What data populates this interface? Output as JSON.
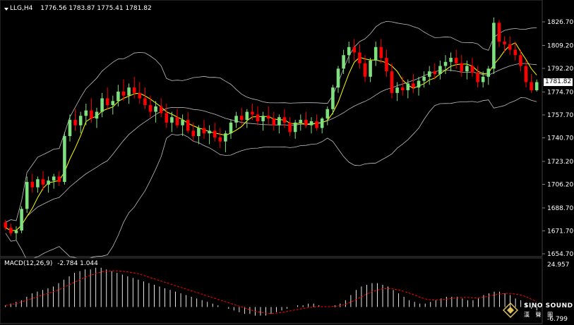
{
  "header": {
    "symbol_tf": "LLG,H4",
    "ohlc": "1776.56 1783.87 1775.41 1781.82"
  },
  "macd_header": {
    "label": "MACD(12,26,9)",
    "values": "-2.784 1.044"
  },
  "current_price_label": "1781.82",
  "logo": {
    "name": "SINO SOUND",
    "sub": "漢 聲 圖"
  },
  "colors": {
    "bull": "#7fe07f",
    "bear": "#ff0000",
    "ma": "#ffff00",
    "bands": "#bfbfbf",
    "macd_signal": "#ff0000",
    "macd_hist": "#ffffff"
  },
  "chart_data": [
    {
      "type": "candlestick",
      "yaxis_ticks": [
        1826.7,
        1809.2,
        1792.2,
        1774.7,
        1757.7,
        1740.7,
        1723.2,
        1706.2,
        1688.7,
        1671.7,
        1654.7
      ],
      "ylim": [
        1654.7,
        1834
      ],
      "ohlc": [
        [
          1678,
          1680,
          1672,
          1674
        ],
        [
          1674,
          1677,
          1668,
          1670
        ],
        [
          1670,
          1675,
          1665,
          1672
        ],
        [
          1672,
          1690,
          1670,
          1688
        ],
        [
          1688,
          1712,
          1685,
          1708
        ],
        [
          1708,
          1714,
          1700,
          1704
        ],
        [
          1704,
          1712,
          1700,
          1710
        ],
        [
          1710,
          1716,
          1702,
          1706
        ],
        [
          1706,
          1712,
          1700,
          1709
        ],
        [
          1709,
          1714,
          1703,
          1712
        ],
        [
          1712,
          1716,
          1705,
          1708
        ],
        [
          1708,
          1745,
          1706,
          1742
        ],
        [
          1742,
          1758,
          1738,
          1754
        ],
        [
          1754,
          1762,
          1746,
          1750
        ],
        [
          1750,
          1760,
          1744,
          1757
        ],
        [
          1757,
          1766,
          1750,
          1761
        ],
        [
          1761,
          1770,
          1752,
          1755
        ],
        [
          1755,
          1763,
          1748,
          1760
        ],
        [
          1760,
          1774,
          1756,
          1770
        ],
        [
          1770,
          1778,
          1762,
          1765
        ],
        [
          1765,
          1772,
          1758,
          1768
        ],
        [
          1768,
          1780,
          1764,
          1775
        ],
        [
          1775,
          1784,
          1768,
          1772
        ],
        [
          1772,
          1781,
          1766,
          1778
        ],
        [
          1778,
          1786,
          1770,
          1774
        ],
        [
          1774,
          1782,
          1766,
          1770
        ],
        [
          1770,
          1778,
          1762,
          1765
        ],
        [
          1765,
          1772,
          1756,
          1760
        ],
        [
          1760,
          1768,
          1752,
          1764
        ],
        [
          1764,
          1770,
          1756,
          1759
        ],
        [
          1759,
          1766,
          1748,
          1752
        ],
        [
          1752,
          1760,
          1745,
          1756
        ],
        [
          1756,
          1762,
          1748,
          1750
        ],
        [
          1750,
          1758,
          1742,
          1754
        ],
        [
          1754,
          1760,
          1744,
          1746
        ],
        [
          1746,
          1752,
          1738,
          1742
        ],
        [
          1742,
          1750,
          1736,
          1748
        ],
        [
          1748,
          1754,
          1740,
          1744
        ],
        [
          1744,
          1750,
          1736,
          1746
        ],
        [
          1746,
          1752,
          1738,
          1741
        ],
        [
          1741,
          1748,
          1733,
          1738
        ],
        [
          1738,
          1746,
          1730,
          1744
        ],
        [
          1744,
          1754,
          1740,
          1752
        ],
        [
          1752,
          1760,
          1748,
          1757
        ],
        [
          1757,
          1763,
          1750,
          1754
        ],
        [
          1754,
          1762,
          1748,
          1760
        ],
        [
          1760,
          1766,
          1754,
          1758
        ],
        [
          1758,
          1764,
          1750,
          1753
        ],
        [
          1753,
          1760,
          1746,
          1757
        ],
        [
          1757,
          1764,
          1750,
          1755
        ],
        [
          1755,
          1760,
          1746,
          1750
        ],
        [
          1750,
          1758,
          1744,
          1756
        ],
        [
          1756,
          1762,
          1748,
          1752
        ],
        [
          1752,
          1756,
          1742,
          1745
        ],
        [
          1745,
          1754,
          1740,
          1752
        ],
        [
          1752,
          1758,
          1746,
          1754
        ],
        [
          1754,
          1760,
          1748,
          1750
        ],
        [
          1750,
          1756,
          1744,
          1753
        ],
        [
          1753,
          1758,
          1746,
          1748
        ],
        [
          1748,
          1756,
          1744,
          1755
        ],
        [
          1755,
          1764,
          1750,
          1762
        ],
        [
          1762,
          1780,
          1758,
          1778
        ],
        [
          1778,
          1794,
          1774,
          1792
        ],
        [
          1792,
          1806,
          1788,
          1802
        ],
        [
          1802,
          1812,
          1796,
          1808
        ],
        [
          1808,
          1814,
          1798,
          1804
        ],
        [
          1804,
          1810,
          1792,
          1796
        ],
        [
          1796,
          1802,
          1782,
          1786
        ],
        [
          1786,
          1800,
          1782,
          1798
        ],
        [
          1798,
          1812,
          1794,
          1808
        ],
        [
          1808,
          1814,
          1796,
          1800
        ],
        [
          1800,
          1806,
          1786,
          1790
        ],
        [
          1790,
          1796,
          1770,
          1774
        ],
        [
          1774,
          1782,
          1768,
          1778
        ],
        [
          1778,
          1786,
          1772,
          1776
        ],
        [
          1776,
          1784,
          1770,
          1781
        ],
        [
          1781,
          1788,
          1774,
          1778
        ],
        [
          1778,
          1786,
          1772,
          1783
        ],
        [
          1783,
          1790,
          1778,
          1786
        ],
        [
          1786,
          1794,
          1780,
          1790
        ],
        [
          1790,
          1796,
          1784,
          1788
        ],
        [
          1788,
          1798,
          1784,
          1794
        ],
        [
          1794,
          1802,
          1788,
          1797
        ],
        [
          1797,
          1804,
          1790,
          1800
        ],
        [
          1800,
          1806,
          1792,
          1796
        ],
        [
          1796,
          1802,
          1786,
          1790
        ],
        [
          1790,
          1798,
          1784,
          1794
        ],
        [
          1794,
          1800,
          1786,
          1789
        ],
        [
          1789,
          1794,
          1778,
          1782
        ],
        [
          1782,
          1790,
          1778,
          1786
        ],
        [
          1786,
          1794,
          1780,
          1792
        ],
        [
          1792,
          1830,
          1788,
          1826
        ],
        [
          1826,
          1828,
          1808,
          1812
        ],
        [
          1812,
          1816,
          1804,
          1810
        ],
        [
          1810,
          1816,
          1802,
          1806
        ],
        [
          1806,
          1812,
          1798,
          1802
        ],
        [
          1802,
          1806,
          1790,
          1794
        ],
        [
          1794,
          1798,
          1778,
          1782
        ],
        [
          1782,
          1788,
          1774,
          1776
        ],
        [
          1776,
          1784,
          1775,
          1782
        ]
      ]
    },
    {
      "type": "macd",
      "yaxis_ticks": [
        24.957,
        -6.799
      ],
      "ylim": [
        -6.799,
        24.957
      ],
      "histogram": [
        1,
        2,
        3,
        4,
        6,
        8,
        9,
        10,
        11,
        12,
        14,
        16,
        18,
        20,
        21,
        22,
        22,
        23,
        23,
        22,
        21,
        20,
        19,
        18,
        17,
        16,
        15,
        14,
        13,
        12,
        11,
        10,
        9,
        8,
        7,
        6,
        5,
        4,
        3,
        2,
        1,
        0,
        -1,
        -2,
        -3,
        -4,
        -4,
        -5,
        -5,
        -5,
        -4,
        -3,
        -2,
        -1,
        0,
        1,
        1,
        2,
        2,
        1,
        0,
        0,
        1,
        2,
        4,
        7,
        10,
        12,
        13,
        14,
        14,
        13,
        12,
        10,
        8,
        6,
        4,
        3,
        2,
        2,
        3,
        4,
        5,
        6,
        6,
        6,
        5,
        4,
        4,
        5,
        7,
        8,
        9,
        9,
        8,
        7,
        5,
        4,
        2,
        -1,
        -2
      ],
      "signal": [
        1,
        1.5,
        2,
        3,
        4,
        5,
        6,
        7,
        8,
        9,
        10,
        11.5,
        13,
        14.5,
        16,
        17.5,
        18.5,
        19.5,
        20.5,
        21,
        21.2,
        21.2,
        21,
        20.5,
        20,
        19.5,
        18.5,
        17.5,
        16.5,
        15.5,
        14.5,
        13.5,
        12.5,
        11.5,
        10.5,
        9.5,
        8.5,
        7.5,
        6.5,
        5.5,
        4.5,
        3.5,
        2.5,
        1.5,
        0.5,
        -0.5,
        -1.5,
        -2.5,
        -3,
        -3.5,
        -3.8,
        -3.6,
        -3.2,
        -2.6,
        -2,
        -1.4,
        -0.8,
        -0.4,
        0,
        0.2,
        0.2,
        0.2,
        0.4,
        0.8,
        1.6,
        2.8,
        4.4,
        6,
        7.6,
        9,
        10,
        10.6,
        10.8,
        10.6,
        10,
        9.2,
        8.2,
        7,
        5.8,
        4.8,
        4.2,
        4,
        4.2,
        4.6,
        5,
        5.4,
        5.6,
        5.6,
        5.4,
        5.4,
        5.8,
        6.4,
        7,
        7.6,
        8,
        8,
        7.6,
        7,
        6,
        4.6,
        3.2
      ]
    }
  ]
}
